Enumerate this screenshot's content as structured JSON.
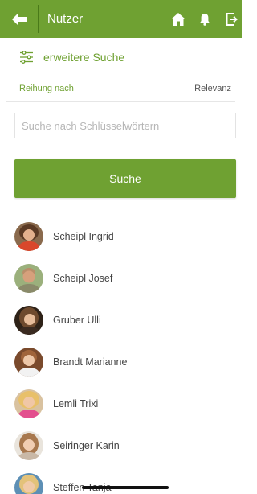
{
  "appbar": {
    "title": "Nutzer",
    "color": "#6fa132",
    "icons": [
      "back-arrow-icon",
      "home-icon",
      "bell-icon",
      "logout-icon"
    ]
  },
  "advanced_search": {
    "label": "erweitere Suche",
    "icon": "filter-sliders-icon"
  },
  "sort": {
    "label": "Reihung nach",
    "value": "Relevanz"
  },
  "search": {
    "placeholder": "Suche nach Schlüsselwörtern",
    "value": ""
  },
  "search_button": {
    "label": "Suche"
  },
  "users": [
    {
      "name": "Scheipl Ingrid"
    },
    {
      "name": "Scheipl Josef"
    },
    {
      "name": "Gruber Ulli"
    },
    {
      "name": "Brandt Marianne"
    },
    {
      "name": "Lemli Trixi"
    },
    {
      "name": "Seiringer Karin"
    },
    {
      "name": "Steffen Tanja"
    }
  ]
}
